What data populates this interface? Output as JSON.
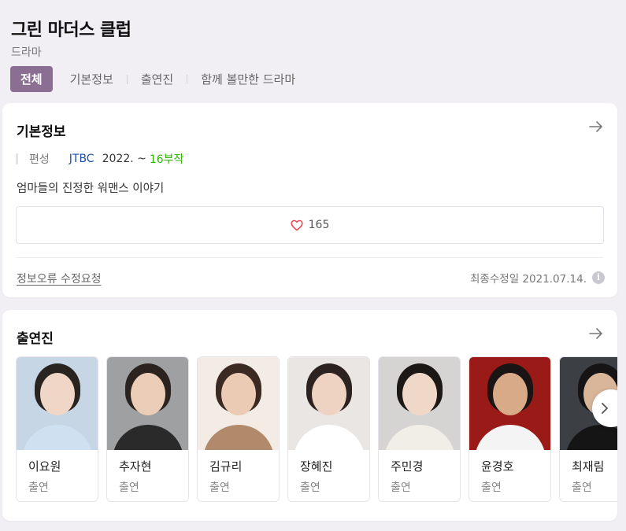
{
  "header": {
    "title": "그린 마더스 클럽",
    "subtitle": "드라마"
  },
  "tabs": [
    {
      "label": "전체",
      "active": true
    },
    {
      "label": "기본정보",
      "active": false
    },
    {
      "label": "출연진",
      "active": false
    },
    {
      "label": "함께 볼만한 드라마",
      "active": false
    }
  ],
  "info": {
    "section_title": "기본정보",
    "meta_label": "편성",
    "channel": "JTBC",
    "date": "2022. ~",
    "episodes": "16부작",
    "synopsis": "엄마들의 진정한 워맨스 이야기",
    "likes": "165",
    "report_link": "정보오류 수정요청",
    "updated": "최종수정일 2021.07.14.",
    "info_icon": "i"
  },
  "cast": {
    "section_title": "출연진",
    "members": [
      {
        "name": "이요원",
        "role": "출연",
        "bg": "#c7d6e4",
        "hair": "#2a2420",
        "skin": "#efd6c6",
        "cloth": "#cfe0f0"
      },
      {
        "name": "추자현",
        "role": "출연",
        "bg": "#9ea0a2",
        "hair": "#2b2320",
        "skin": "#eccdb8",
        "cloth": "#2a2a2a"
      },
      {
        "name": "김규리",
        "role": "출연",
        "bg": "#f3ece4",
        "hair": "#3a2a22",
        "skin": "#ebcbb3",
        "cloth": "#b08a6a"
      },
      {
        "name": "장혜진",
        "role": "출연",
        "bg": "#e9e6e4",
        "hair": "#2c2220",
        "skin": "#efd3c2",
        "cloth": "#ffffff"
      },
      {
        "name": "주민경",
        "role": "출연",
        "bg": "#d6d4d2",
        "hair": "#1c1816",
        "skin": "#f0d8c8",
        "cloth": "#f1eee8"
      },
      {
        "name": "윤경호",
        "role": "출연",
        "bg": "#9a1a18",
        "hair": "#1a1414",
        "skin": "#d9aa88",
        "cloth": "#f4f4f4"
      },
      {
        "name": "최재림",
        "role": "출연",
        "bg": "#3c3f44",
        "hair": "#161414",
        "skin": "#d9b69a",
        "cloth": "#151515"
      }
    ]
  },
  "icons": {
    "arrow": "arrow-right-icon",
    "heart": "heart-outline-icon",
    "next": "chevron-right-icon"
  },
  "colors": {
    "accent": "#8b6f93",
    "channel": "#1e4fa8",
    "episodes": "#2db400",
    "heart": "#e8474f"
  }
}
